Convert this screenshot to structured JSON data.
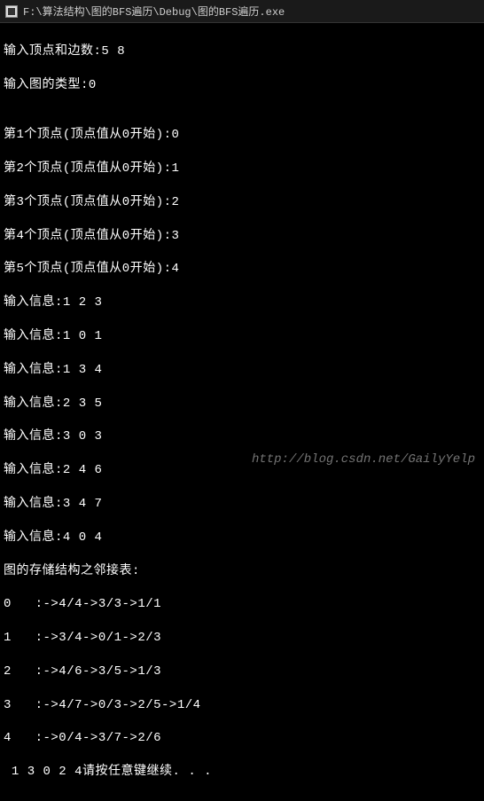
{
  "window": {
    "title": "F:\\算法结构\\图的BFS遍历\\Debug\\图的BFS遍历.exe"
  },
  "lines": {
    "l0": "输入顶点和边数:5 8",
    "l1": "输入图的类型:0",
    "l2": "",
    "l3": "第1个顶点(顶点值从0开始):0",
    "l4": "第2个顶点(顶点值从0开始):1",
    "l5": "第3个顶点(顶点值从0开始):2",
    "l6": "第4个顶点(顶点值从0开始):3",
    "l7": "第5个顶点(顶点值从0开始):4",
    "l8": "输入信息:1 2 3",
    "l9": "输入信息:1 0 1",
    "l10": "输入信息:1 3 4",
    "l11": "输入信息:2 3 5",
    "l12": "输入信息:3 0 3",
    "l13": "输入信息:2 4 6",
    "l14": "输入信息:3 4 7",
    "l15": "输入信息:4 0 4",
    "l16": "图的存储结构之邻接表:",
    "l17": "0   :->4/4->3/3->1/1",
    "l18": "1   :->3/4->0/1->2/3",
    "l19": "2   :->4/6->3/5->1/3",
    "l20": "3   :->4/7->0/3->2/5->1/4",
    "l21": "4   :->0/4->3/7->2/6",
    "l22": " 1 3 0 2 4请按任意键继续. . ."
  },
  "watermark": "http://blog.csdn.net/GailyYelp"
}
